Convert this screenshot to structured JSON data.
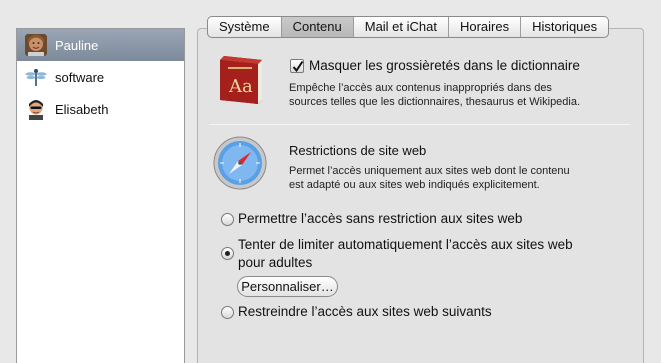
{
  "users": [
    {
      "name": "Pauline",
      "avatar": "user-photo-icon",
      "selected": true
    },
    {
      "name": "software",
      "avatar": "dragonfly-icon",
      "selected": false
    },
    {
      "name": "Elisabeth",
      "avatar": "user-photo-icon",
      "selected": false
    }
  ],
  "tabs": [
    {
      "label": "Système"
    },
    {
      "label": "Contenu",
      "active": true
    },
    {
      "label": "Mail et iChat"
    },
    {
      "label": "Horaires"
    },
    {
      "label": "Historiques"
    }
  ],
  "dictionary": {
    "icon": "dictionary-icon",
    "checked": true,
    "checkbox_label": "Masquer les grossièretés dans le dictionnaire",
    "description_line1": "Empêche l’accès aux contenus inappropriés dans des",
    "description_line2": "sources telles que les dictionnaires, thesaurus et Wikipedia."
  },
  "web": {
    "icon": "safari-compass-icon",
    "title": "Restrictions de site web",
    "description_line1": "Permet l’accès uniquement aux sites web dont le contenu",
    "description_line2": "est adapté ou aux sites web indiqués explicitement.",
    "options": [
      {
        "label_line1": "Permettre l’accès sans restriction aux sites web",
        "selected": false
      },
      {
        "label_line1": "Tenter de limiter automatiquement l’accès aux sites web",
        "label_line2": "pour adultes",
        "selected": true
      },
      {
        "label_line1": "Restreindre l’accès aux sites web suivants",
        "selected": false
      }
    ],
    "customize_label": "Personnaliser…"
  },
  "colors": {
    "selection": "#8a96a6",
    "window_bg": "#e8e8e8"
  }
}
